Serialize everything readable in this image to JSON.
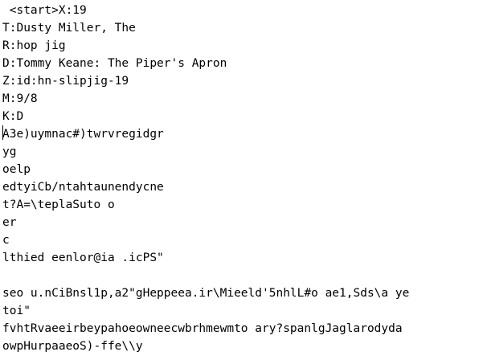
{
  "editor": {
    "lines": [
      " <start>X:19",
      "T:Dusty Miller, The",
      "R:hop jig",
      "D:Tommy Keane: The Piper's Apron",
      "Z:id:hn-slipjig-19",
      "M:9/8",
      "K:D",
      "A3e)uymnac#)twrvregidgr",
      "yg",
      "oelp",
      "edtyiCb/ntahtaunendycne",
      "t?A=\\teplaSuto o",
      "er",
      "c",
      "lthied eenlor@ia .icPS\"",
      "",
      "seo u.nCiBnsl1p,a2\"gHeppeea.ir\\Mieeld'5nhlL#o ae1,Sds\\a ye",
      "toi\"",
      "fvhtRvaeeirbeypahoeowneecwbrhmewmto ary?spanlgJaglarodyda",
      "owpHurpaaeoS)-ffe\\\\y"
    ]
  }
}
